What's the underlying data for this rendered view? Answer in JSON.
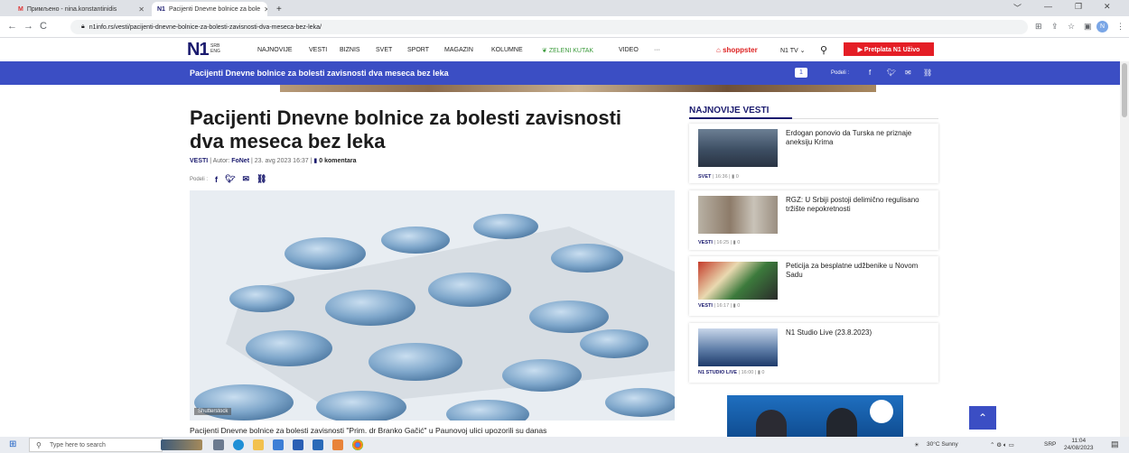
{
  "browser": {
    "tabs": [
      {
        "label": "Примљено - nina.konstantinidis",
        "icon": "gmail-icon",
        "active": false
      },
      {
        "label": "Pacijenti Dnevne bolnice za bole",
        "icon": "n1-icon",
        "active": true
      }
    ],
    "new_tab": "+",
    "url": "n1info.rs/vesti/pacijenti-dnevne-bolnice-za-bolesti-zavisnosti-dva-meseca-bez-leka/",
    "profile_initial": "N"
  },
  "site": {
    "logo": "N1",
    "lang": [
      "SRB",
      "ENG"
    ],
    "nav": [
      "NAJNOVIJE",
      "VESTI",
      "BIZNIS",
      "SVET",
      "SPORT",
      "MAGAZIN",
      "KOLUMNE",
      "ZELENI KUTAK",
      "VIDEO",
      "···"
    ],
    "shoppster": "shoppster",
    "n1tv": "N1 TV",
    "pretplata": "▶ Pretplata N1 Uživo"
  },
  "banner": {
    "title": "Pacijenti Dnevne bolnice za bolesti zavisnosti dva meseca bez leka",
    "comment_count": "1",
    "share_label": "Podeli :"
  },
  "article": {
    "headline": "Pacijenti Dnevne bolnice za bolesti zavisnosti dva meseca bez leka",
    "category": "VESTI",
    "author_prefix": "| Autor:",
    "author": "FoNet",
    "date": "| 23. avg 2023 16:37 |",
    "comments": "0 komentara",
    "share_label": "Podeli :",
    "photo_credit": "Shutterstock",
    "lead": "Pacijenti Dnevne bolnice za bolesti zavisnosti \"Prim. dr Branko Gačić\" u Paunovoj ulici upozorili su danas"
  },
  "sidebar": {
    "title": "NAJNOVIJE VESTI",
    "items": [
      {
        "title": "Erdogan ponovio da Turska ne priznaje aneksiju Krima",
        "category": "SVET",
        "time": "| 16:36 |",
        "comments": "0"
      },
      {
        "title": "RGZ: U Srbiji postoji delimično regulisano tržište nepokretnosti",
        "category": "VESTI",
        "time": "| 16:25 |",
        "comments": "0"
      },
      {
        "title": "Peticija za besplatne udžbenike u Novom Sadu",
        "category": "VESTI",
        "time": "| 16:17 |",
        "comments": "0"
      },
      {
        "title": "N1 Studio Live (23.8.2023)",
        "category": "N1 STUDIO LIVE",
        "time": "| 16:00 |",
        "comments": "0"
      }
    ]
  },
  "taskbar": {
    "search_placeholder": "Type here to search",
    "weather": "30°C  Sunny",
    "lang": "SRP",
    "time": "11:04",
    "date": "24/08/2023"
  },
  "colors": {
    "brand_blue": "#3b4ec4",
    "navy": "#1a1a6e",
    "red": "#e41e26"
  }
}
